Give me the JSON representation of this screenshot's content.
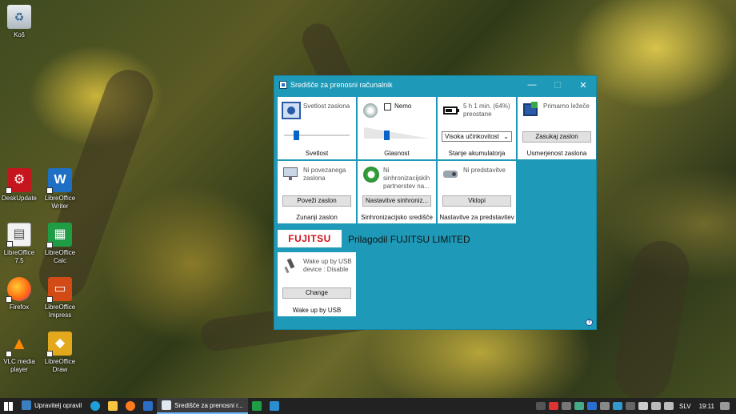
{
  "desktop": {
    "icons": [
      {
        "label": "Koš",
        "icon": "recycle-bin-icon"
      },
      {
        "label": "DeskUpdate",
        "icon": "deskupdate-icon"
      },
      {
        "label": "LibreOffice Writer",
        "icon": "writer-icon"
      },
      {
        "label": "LibreOffice 7.5",
        "icon": "libreoffice-icon"
      },
      {
        "label": "LibreOffice Calc",
        "icon": "calc-icon"
      },
      {
        "label": "Firefox",
        "icon": "firefox-icon"
      },
      {
        "label": "LibreOffice Impress",
        "icon": "impress-icon"
      },
      {
        "label": "VLC media player",
        "icon": "vlc-icon"
      },
      {
        "label": "LibreOffice Draw",
        "icon": "draw-icon"
      }
    ]
  },
  "window": {
    "title": "Središče za prenosni računalnik",
    "tiles": {
      "brightness": {
        "label": "Svetlost zaslona",
        "footer": "Svetlost",
        "level": 0.15
      },
      "volume": {
        "label": "Nemo",
        "mute_checked": false,
        "footer": "Glasnost",
        "level": 0.3
      },
      "battery": {
        "label": "5 h 1 min. (64%) preostane",
        "select_value": "Visoka učinkovitost",
        "footer": "Stanje akumulatorja",
        "charge": 0.64
      },
      "orientation": {
        "label": "Primarno ležeče",
        "button": "Zasukaj zaslon",
        "footer": "Usmerjenost zaslona"
      },
      "external_display": {
        "label": "Ni povezanega zaslona",
        "button": "Poveži zaslon",
        "footer": "Zunanji zaslon"
      },
      "sync_center": {
        "label": "Ni sinhronizacijskih partnerstev na...",
        "button": "Nastavitve sinhroniz...",
        "footer": "Sinhronizacijsko središče"
      },
      "presentation": {
        "label": "Ni predstavitve",
        "button": "Vklopi",
        "footer": "Nastavitve za predstavitev"
      },
      "usb_wake": {
        "label": "Wake up by USB device : Disable",
        "button": "Change",
        "footer": "Wake up by USB"
      }
    },
    "brand": {
      "logo_text": "FUJITSU",
      "customized_by": "Prilagodil FUJITSU LIMITED",
      "logo_color": "#d3101a"
    },
    "accent": "#1e9ab8"
  },
  "taskbar": {
    "tasks": [
      {
        "label": "Upravitelj opravil",
        "active": false
      },
      {
        "label": "Središče za prenosni r...",
        "active": true
      }
    ],
    "language": "SLV",
    "clock": "19:11"
  }
}
